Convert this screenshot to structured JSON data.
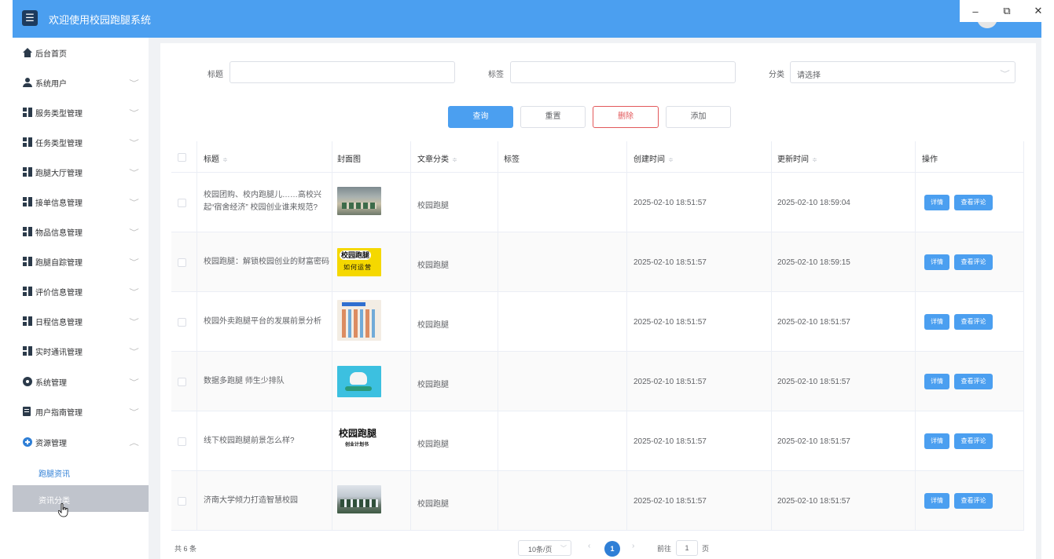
{
  "window": {
    "minimize": "–",
    "restore": "⧉",
    "close": "✕"
  },
  "header": {
    "menu_icon": "☰",
    "title": "欢迎使用校园跑腿系统"
  },
  "sidebar": {
    "items": [
      {
        "label": "后台首页",
        "icon": "home-icon"
      },
      {
        "label": "系统用户",
        "icon": "user-icon",
        "expanded": false
      },
      {
        "label": "服务类型管理",
        "icon": "grid-icon",
        "expanded": false
      },
      {
        "label": "任务类型管理",
        "icon": "grid-icon",
        "expanded": false
      },
      {
        "label": "跑腿大厅管理",
        "icon": "grid-icon",
        "expanded": false
      },
      {
        "label": "接单信息管理",
        "icon": "grid-icon",
        "expanded": false
      },
      {
        "label": "物品信息管理",
        "icon": "grid-icon",
        "expanded": false
      },
      {
        "label": "跑腿自踪管理",
        "icon": "grid-icon",
        "expanded": false
      },
      {
        "label": "评价信息管理",
        "icon": "grid-icon",
        "expanded": false
      },
      {
        "label": "日程信息管理",
        "icon": "grid-icon",
        "expanded": false
      },
      {
        "label": "实时通讯管理",
        "icon": "grid-icon",
        "expanded": false
      },
      {
        "label": "系统管理",
        "icon": "gear-icon",
        "expanded": false
      },
      {
        "label": "用户指南管理",
        "icon": "doc-icon",
        "expanded": false
      },
      {
        "label": "资源管理",
        "icon": "plus-circle-icon",
        "expanded": true
      }
    ],
    "sub_items": [
      {
        "label": "跑腿资讯",
        "active": false
      },
      {
        "label": "资讯分类",
        "active": true
      }
    ],
    "chevron_down": "﹀",
    "chevron_up": "︿"
  },
  "search": {
    "title_label": "标题",
    "title_value": "",
    "tag_label": "标签",
    "tag_value": "",
    "category_label": "分类",
    "category_placeholder": "请选择",
    "chevron": "﹀"
  },
  "toolbar": {
    "query": "查询",
    "reset": "重置",
    "delete": "删除",
    "add": "添加"
  },
  "table": {
    "columns": {
      "title": "标题",
      "cover": "封面图",
      "category": "文章分类",
      "tags": "标签",
      "created": "创建时间",
      "updated": "更新时间",
      "actions": "操作"
    },
    "sort_icon": "≑",
    "rows": [
      {
        "title": "校园团购、校内跑腿儿……高校兴起“宿舍经济” 校园创业谁来规范?",
        "category": "校园跑腿",
        "tags": "",
        "created": "2025-02-10 18:51:57",
        "updated": "2025-02-10 18:59:04",
        "detail": "详情",
        "comments": "查看评论"
      },
      {
        "title": "校园跑腿：解锁校园创业的财富密码",
        "category": "校园跑腿",
        "tags": "",
        "created": "2025-02-10 18:51:57",
        "updated": "2025-02-10 18:59:15",
        "detail": "详情",
        "comments": "查看评论"
      },
      {
        "title": "校园外卖跑腿平台的发展前景分析",
        "category": "校园跑腿",
        "tags": "",
        "created": "2025-02-10 18:51:57",
        "updated": "2025-02-10 18:51:57",
        "detail": "详情",
        "comments": "查看评论"
      },
      {
        "title": "数据多跑腿 师生少排队",
        "category": "校园跑腿",
        "tags": "",
        "created": "2025-02-10 18:51:57",
        "updated": "2025-02-10 18:51:57",
        "detail": "详情",
        "comments": "查看评论"
      },
      {
        "title": "线下校园跑腿前景怎么样?",
        "category": "校园跑腿",
        "tags": "",
        "created": "2025-02-10 18:51:57",
        "updated": "2025-02-10 18:51:57",
        "detail": "详情",
        "comments": "查看评论"
      },
      {
        "title": "济南大学倾力打造智慧校园",
        "category": "校园跑腿",
        "tags": "",
        "created": "2025-02-10 18:51:57",
        "updated": "2025-02-10 18:51:57",
        "detail": "详情",
        "comments": "查看评论"
      }
    ]
  },
  "pagination": {
    "total": "共 6 条",
    "page_size": "10条/页",
    "prev": "‹",
    "next": "›",
    "current": "1",
    "goto_label": "前往",
    "goto_value": "1",
    "page_suffix": "页",
    "chevron": "﹀"
  }
}
